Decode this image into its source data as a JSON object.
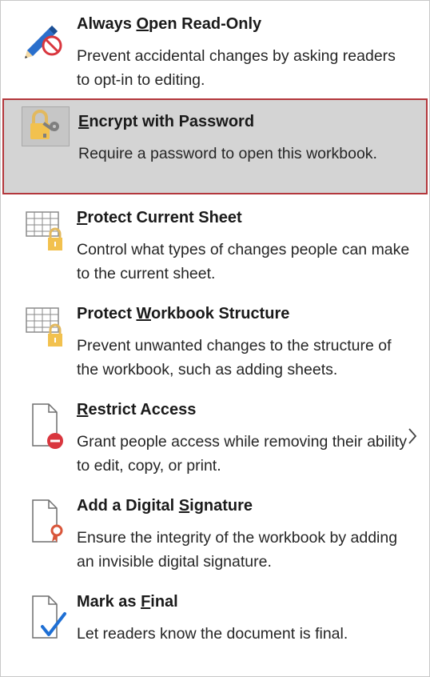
{
  "colors": {
    "selected_bg": "#d4d4d4",
    "selected_border": "#b3373c",
    "lock_gold": "#f2c14e",
    "icon_blue": "#1e6fd4",
    "icon_red": "#d9363e"
  },
  "menu": {
    "items": [
      {
        "icon": "pencil-no-icon",
        "title_parts": [
          "Always ",
          "O",
          "pen Read-Only"
        ],
        "description": "Prevent accidental changes by asking readers to opt-in to editing."
      },
      {
        "icon": "lock-key-icon",
        "title_parts": [
          "",
          "E",
          "ncrypt with Password"
        ],
        "description": "Require a password to open this workbook.",
        "selected": true
      },
      {
        "icon": "sheet-lock-icon",
        "title_parts": [
          "",
          "P",
          "rotect Current Sheet"
        ],
        "description": "Control what types of changes people can make to the current sheet."
      },
      {
        "icon": "workbook-lock-icon",
        "title_parts": [
          "Protect ",
          "W",
          "orkbook Structure"
        ],
        "description": "Prevent unwanted changes to the structure of the workbook, such as adding sheets."
      },
      {
        "icon": "document-restrict-icon",
        "title_parts": [
          "",
          "R",
          "estrict Access"
        ],
        "description": "Grant people access while removing their ability to edit, copy, or print.",
        "has_submenu": true,
        "submenu_icon": "chevron-right-icon"
      },
      {
        "icon": "document-signature-icon",
        "title_parts": [
          "Add a Digital ",
          "S",
          "ignature"
        ],
        "description": "Ensure the integrity of the workbook by adding an invisible digital signature."
      },
      {
        "icon": "document-final-icon",
        "title_parts": [
          "Mark as ",
          "F",
          "inal"
        ],
        "description": "Let readers know the document is final."
      }
    ]
  }
}
